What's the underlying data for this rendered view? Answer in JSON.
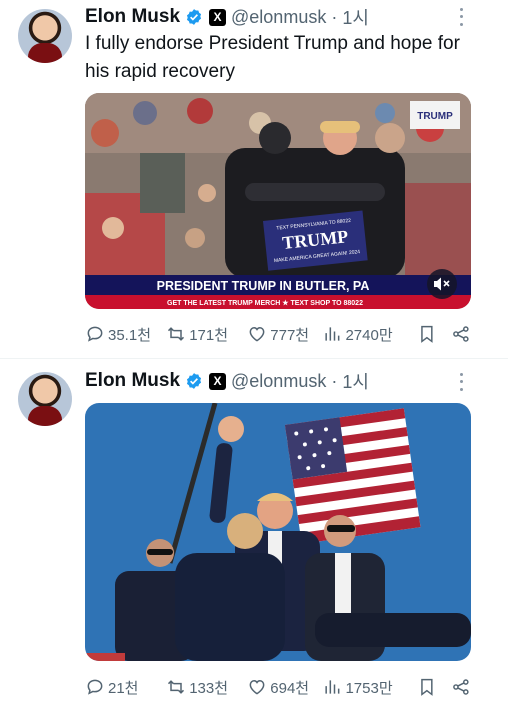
{
  "tweets": [
    {
      "author_name": "Elon Musk",
      "handle": "@elonmusk",
      "dot": "·",
      "time": "1시",
      "x_badge": "X",
      "text": "I fully endorse President Trump and hope for his rapid recovery",
      "media": {
        "icon": "rally-photo",
        "sign_top": "TEXT PENNSYLVANIA TO 88022",
        "sign_main": "TRUMP",
        "sign_sub": "MAKE AMERICA GREAT AGAIN! 2024",
        "corner_label": "TRUMP",
        "banner_line1": "PRESIDENT TRUMP IN BUTLER, PA",
        "banner_line2": "GET THE LATEST TRUMP MERCH ★ TEXT SHOP TO 88022",
        "mute_icon": "speaker-mute-icon"
      },
      "stats": {
        "replies": "35.1천",
        "retweets": "171천",
        "likes": "777천",
        "views": "2740만"
      }
    },
    {
      "author_name": "Elon Musk",
      "handle": "@elonmusk",
      "dot": "·",
      "time": "1시",
      "x_badge": "X",
      "media": {
        "icon": "flag-photo"
      },
      "stats": {
        "replies": "21천",
        "retweets": "133천",
        "likes": "694천",
        "views": "1753만"
      }
    }
  ],
  "colors": {
    "verified": "#1d9bf0",
    "muted_text": "#536471",
    "sky": "#2f73b5",
    "banner_navy": "#14145a",
    "banner_red": "#c8102e"
  }
}
